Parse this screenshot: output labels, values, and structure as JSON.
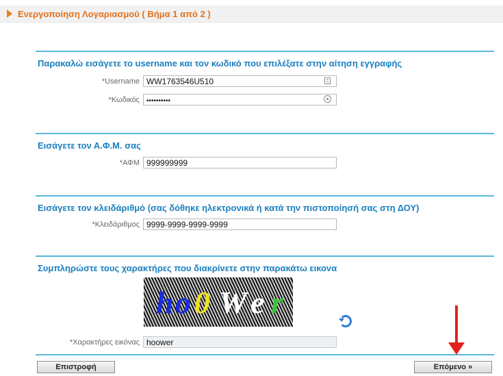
{
  "header": {
    "title": "Ενεργοποίηση Λογαριασμού ( Βήμα 1 από 2 )"
  },
  "sections": {
    "credentials": {
      "title": "Παρακαλώ εισάγετε το username και τον κωδικό που επιλέξατε στην αίτηση εγγραφής",
      "username_label": "*Username",
      "username_value": "WW1763546U510",
      "password_label": "*Κωδικός",
      "password_value": "••••••••••"
    },
    "afm": {
      "title": "Εισάγετε τον Α.Φ.Μ. σας",
      "label": "*ΑΦΜ",
      "value": "999999999"
    },
    "key": {
      "title": "Εισάγετε τον κλειδάριθμό (σας δόθηκε ηλεκτρονικά ή κατά την πιστοποίησή σας στη ΔΟΥ)",
      "label": "*Κλειδάριθμος",
      "value": "9999-9999-9999-9999"
    },
    "captcha": {
      "title": "Συμπληρώστε τους χαρακτήρες που διακρίνετε στην παρακάτω εικονα",
      "chars": [
        {
          "ch": "h",
          "color": "#1a2ee0"
        },
        {
          "ch": "o",
          "color": "#1a2ee0"
        },
        {
          "ch": "0",
          "color": "#f0e020"
        },
        {
          "ch": "W",
          "color": "#ffffff"
        },
        {
          "ch": "e",
          "color": "#ffffff"
        },
        {
          "ch": "r",
          "color": "#3ec23e"
        }
      ],
      "label": "*Χαρακτήρες εικόνας",
      "value": "hoower"
    }
  },
  "buttons": {
    "back": "Επιστροφή",
    "next": "Επόμενο »"
  },
  "colors": {
    "accent_orange": "#e2711d",
    "section_blue": "#1a7fbf",
    "rule_blue": "#57b9d9",
    "arrow_red": "#e2211a"
  }
}
